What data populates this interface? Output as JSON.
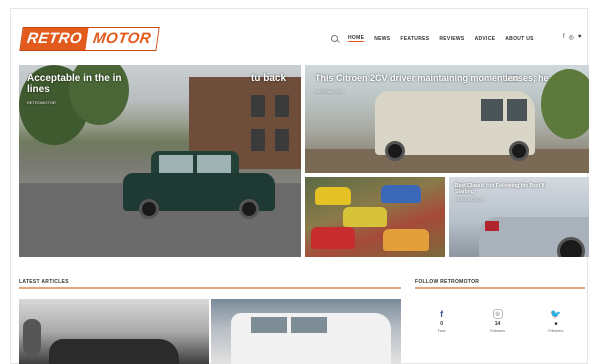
{
  "brand": {
    "part1": "RETRO",
    "part2": "MOTOR"
  },
  "nav": {
    "search_icon": "search-icon",
    "items": [
      "HOME",
      "NEWS",
      "FEATURES",
      "REVIEWS",
      "ADVICE",
      "ABOUT US"
    ],
    "social": [
      "f",
      "◎",
      "♥"
    ]
  },
  "hero": {
    "main_title": "Acceptable in the in lines",
    "main_meta": "RETROMOTOR",
    "main_title_right": "tu back",
    "top_right_title": "This Citroen 2CV driver maintaining momentum",
    "top_right_title_tail": "lenses, he",
    "top_right_meta": "RETROMOTOR",
    "bottom_right_title": "Best Classic Hot Following the Best 8 Starting",
    "bottom_right_meta": "RETROMOTOR"
  },
  "latest": {
    "title": "LATEST ARTICLES"
  },
  "follow": {
    "title": "FOLLOW RETROMOTOR",
    "items": [
      {
        "icon": "facebook-icon",
        "glyph": "f",
        "count": "0",
        "label": "Fans"
      },
      {
        "icon": "instagram-icon",
        "glyph": "◎",
        "count": "14",
        "label": "Followers"
      },
      {
        "icon": "twitter-icon",
        "glyph": "🐦",
        "count": "■",
        "label": "Followers"
      }
    ]
  },
  "colors": {
    "accent": "#e25a1c",
    "rule": "#e9a37f"
  }
}
